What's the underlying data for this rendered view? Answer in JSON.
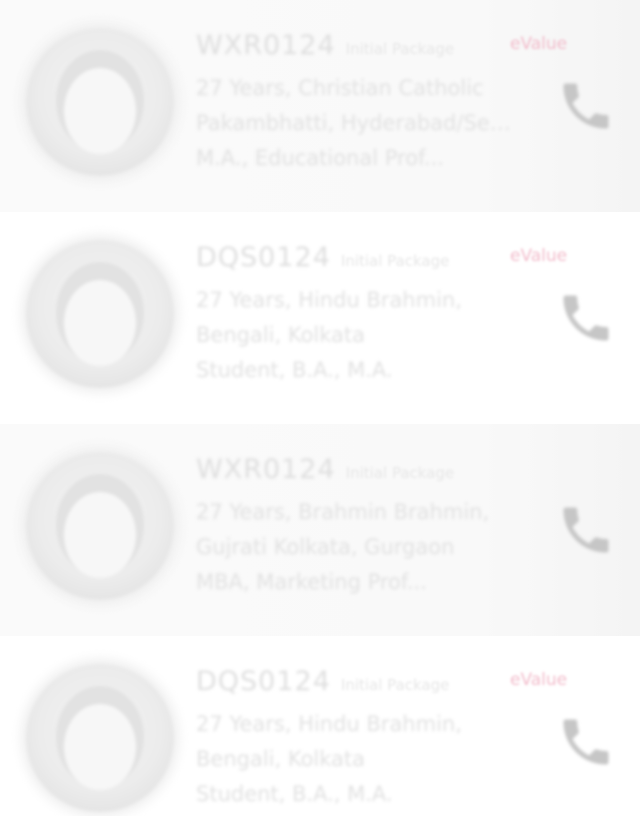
{
  "colors": {
    "badge": "#e06a8c",
    "text": "#b0b0b0",
    "icon": "#b8b8b8"
  },
  "profiles": [
    {
      "id": "WXR0124",
      "plan": "Initial Package",
      "badge": "eValue",
      "line1": "27 Years, Christian Catholic",
      "line2": "Pakambhatti, Hyderabad/Sec...",
      "line3": "M.A., Educational Prof...",
      "call_icon": "phone-icon"
    },
    {
      "id": "DQS0124",
      "plan": "Initial Package",
      "badge": "eValue",
      "line1": "27 Years, Hindu Brahmin,",
      "line2": "Bengali, Kolkata",
      "line3": "Student, B.A., M.A.",
      "call_icon": "phone-icon"
    },
    {
      "id": "WXR0124",
      "plan": "Initial Package",
      "badge": "",
      "line1": "27 Years, Brahmin Brahmin,",
      "line2": "Gujrati Kolkata, Gurgaon",
      "line3": "MBA, Marketing Prof...",
      "call_icon": "phone-icon"
    },
    {
      "id": "DQS0124",
      "plan": "Initial Package",
      "badge": "eValue",
      "line1": "27 Years, Hindu Brahmin,",
      "line2": "Bengali, Kolkata",
      "line3": "Student, B.A., M.A.",
      "call_icon": "phone-icon"
    }
  ]
}
